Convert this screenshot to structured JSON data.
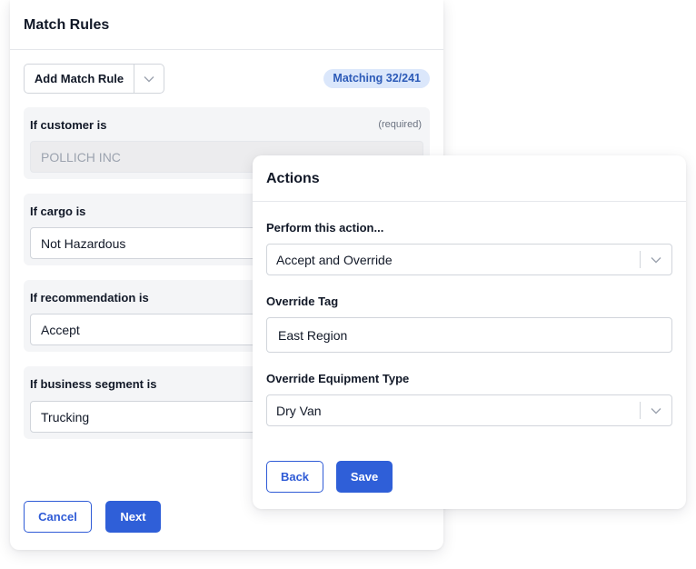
{
  "match_rules": {
    "title": "Match Rules",
    "add_rule_label": "Add Match Rule",
    "matching_badge": "Matching 32/241",
    "rules": [
      {
        "label": "If customer is",
        "required_text": "(required)",
        "value": "POLLICH INC",
        "disabled": true
      },
      {
        "label": "If cargo is",
        "value": "Not Hazardous"
      },
      {
        "label": "If recommendation is",
        "value": "Accept"
      },
      {
        "label": "If business segment is",
        "value": "Trucking"
      }
    ],
    "cancel_label": "Cancel",
    "next_label": "Next"
  },
  "actions": {
    "title": "Actions",
    "perform_label": "Perform this action...",
    "perform_value": "Accept and Override",
    "override_tag_label": "Override Tag",
    "override_tag_value": "East Region",
    "equipment_label": "Override Equipment Type",
    "equipment_value": "Dry Van",
    "back_label": "Back",
    "save_label": "Save"
  },
  "colors": {
    "primary": "#2f5fd8",
    "badge_bg": "#dbe7fb",
    "badge_text": "#2d5bb8",
    "panel_bg": "#f4f5f7"
  }
}
